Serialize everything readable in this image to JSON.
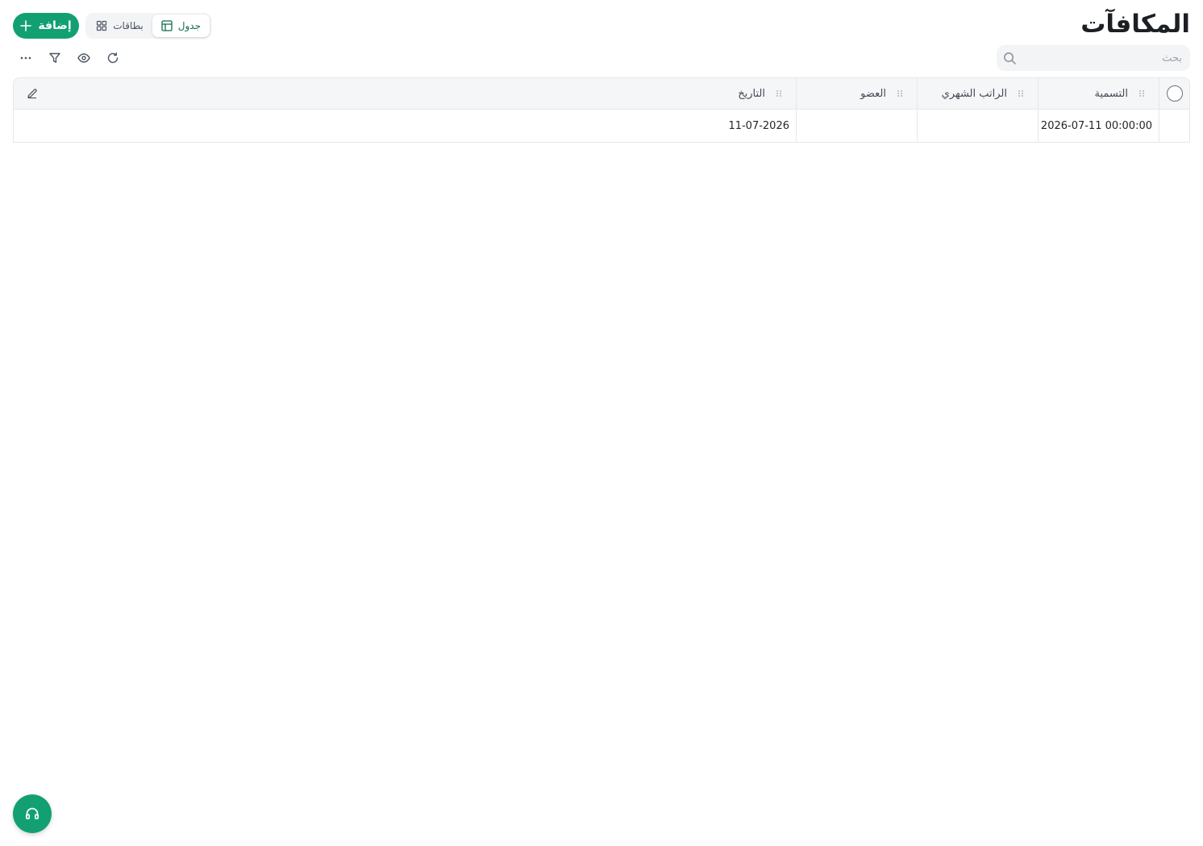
{
  "page": {
    "title": "المكافآت"
  },
  "actions": {
    "add_label": "إضافة"
  },
  "views": {
    "table_label": "جدول",
    "cards_label": "بطاقات",
    "active": "table"
  },
  "search": {
    "placeholder": "بحث",
    "value": ""
  },
  "toolbar": {
    "icons": [
      "refresh-icon",
      "eye-icon",
      "filter-icon",
      "more-icon"
    ]
  },
  "table": {
    "columns": [
      "التسمية",
      "الراتب الشهري",
      "العضو",
      "التاريخ"
    ],
    "rows": [
      {
        "label": "2026-07-11 00:00:00",
        "monthly_salary": "",
        "member": "",
        "date": "11-07-2026"
      }
    ]
  },
  "colors": {
    "accent": "#12a073",
    "header_bg": "#f5f6f8",
    "border": "#e5e7eb"
  }
}
